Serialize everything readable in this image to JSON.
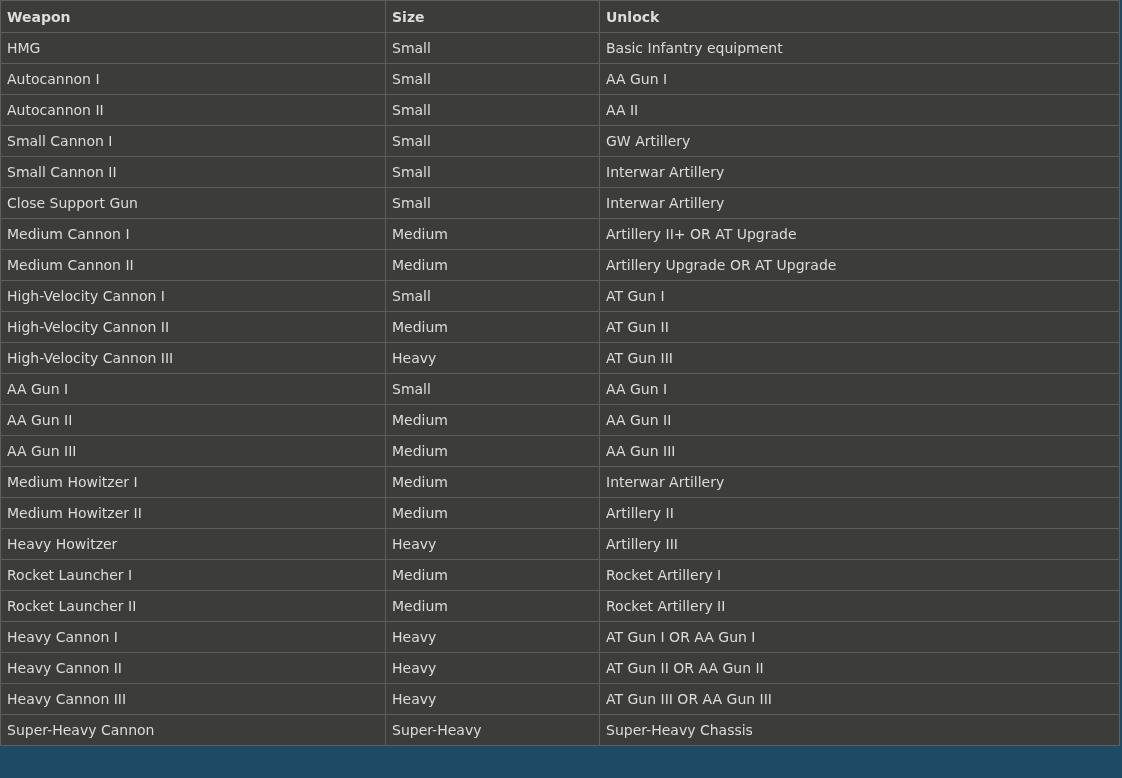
{
  "table": {
    "columns": [
      "Weapon",
      "Size",
      "Unlock"
    ],
    "rows": [
      [
        "HMG",
        "Small",
        "Basic Infantry equipment"
      ],
      [
        "Autocannon I",
        "Small",
        "AA Gun I"
      ],
      [
        "Autocannon II",
        "Small",
        "AA II"
      ],
      [
        "Small Cannon I",
        "Small",
        "GW Artillery"
      ],
      [
        "Small Cannon II",
        "Small",
        "Interwar Artillery"
      ],
      [
        "Close Support Gun",
        "Small",
        "Interwar Artillery"
      ],
      [
        "Medium Cannon I",
        "Medium",
        "Artillery II+ OR AT Upgrade"
      ],
      [
        "Medium Cannon II",
        "Medium",
        "Artillery Upgrade OR AT Upgrade"
      ],
      [
        "High-Velocity Cannon I",
        "Small",
        "AT Gun I"
      ],
      [
        "High-Velocity Cannon II",
        "Medium",
        "AT Gun II"
      ],
      [
        "High-Velocity Cannon III",
        "Heavy",
        "AT Gun III"
      ],
      [
        "AA Gun I",
        "Small",
        "AA Gun I"
      ],
      [
        "AA Gun II",
        "Medium",
        "AA Gun II"
      ],
      [
        "AA Gun III",
        "Medium",
        "AA Gun III"
      ],
      [
        "Medium Howitzer I",
        "Medium",
        "Interwar Artillery"
      ],
      [
        "Medium Howitzer II",
        "Medium",
        "Artillery II"
      ],
      [
        "Heavy Howitzer",
        "Heavy",
        "Artillery III"
      ],
      [
        "Rocket Launcher I",
        "Medium",
        "Rocket Artillery I"
      ],
      [
        "Rocket Launcher II",
        "Medium",
        "Rocket Artillery II"
      ],
      [
        "Heavy Cannon I",
        "Heavy",
        "AT Gun I OR AA Gun I"
      ],
      [
        "Heavy Cannon II",
        "Heavy",
        "AT Gun II OR AA Gun II"
      ],
      [
        "Heavy Cannon III",
        "Heavy",
        "AT Gun III OR AA Gun III"
      ],
      [
        "Super-Heavy Cannon",
        "Super-Heavy",
        "Super-Heavy Chassis"
      ]
    ]
  }
}
